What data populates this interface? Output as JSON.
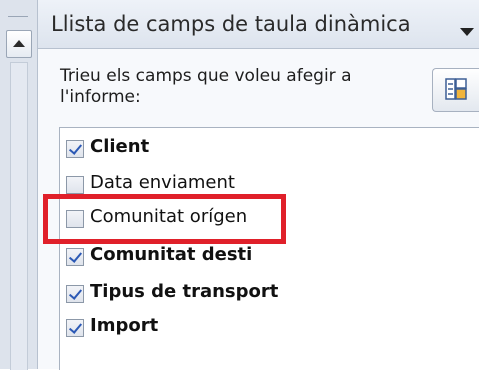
{
  "panel": {
    "title": "Llista de camps de taula dinàmica",
    "instruction": "Trieu els camps que voleu afegir a l'informe:"
  },
  "fields": [
    {
      "label": "Client",
      "checked": true,
      "bold": true
    },
    {
      "label": "Data enviament",
      "checked": false,
      "bold": false
    },
    {
      "label": "Comunitat orígen",
      "checked": false,
      "bold": false
    },
    {
      "label": "Comunitat desti",
      "checked": true,
      "bold": true
    },
    {
      "label": "Tipus de transport",
      "checked": true,
      "bold": true
    },
    {
      "label": "Import",
      "checked": true,
      "bold": true
    }
  ],
  "colors": {
    "highlight": "#e0202a",
    "check": "#2c59b5",
    "panel_bg": "#f7f9fc"
  },
  "icons": {
    "dropdown": "chevron-down-icon",
    "layout": "field-list-layout-icon",
    "scroll": "scroll-up-arrow-icon"
  }
}
